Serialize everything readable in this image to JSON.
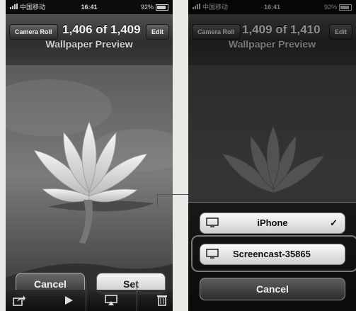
{
  "left": {
    "status": {
      "carrier": "中国移动",
      "time": "16:41",
      "battery": "92%"
    },
    "nav": {
      "back_label": "Camera Roll",
      "title": "1,406 of 1,409",
      "edit_label": "Edit",
      "subtitle": "Wallpaper Preview"
    },
    "cancel_label": "Cancel",
    "set_label": "Set",
    "toolbar_icons": [
      "share-icon",
      "play-icon",
      "airplay-icon",
      "trash-icon"
    ]
  },
  "right": {
    "status": {
      "carrier": "中国移动",
      "time": "16:41",
      "battery": "92%"
    },
    "nav": {
      "back_label": "Camera Roll",
      "title": "1,409 of 1,410",
      "edit_label": "Edit",
      "subtitle": "Wallpaper Preview"
    },
    "airplay_sheet": {
      "routes": [
        {
          "label": "iPhone",
          "selected": true,
          "icon": "monitor-icon"
        },
        {
          "label": "Screencast-35865",
          "selected": false,
          "icon": "monitor-icon"
        }
      ],
      "check_mark": "✓",
      "cancel_label": "Cancel"
    }
  },
  "colors": {
    "background": "#e9e9e6",
    "bar": "#2f2f2f",
    "button_light": "#f7f7f7"
  }
}
